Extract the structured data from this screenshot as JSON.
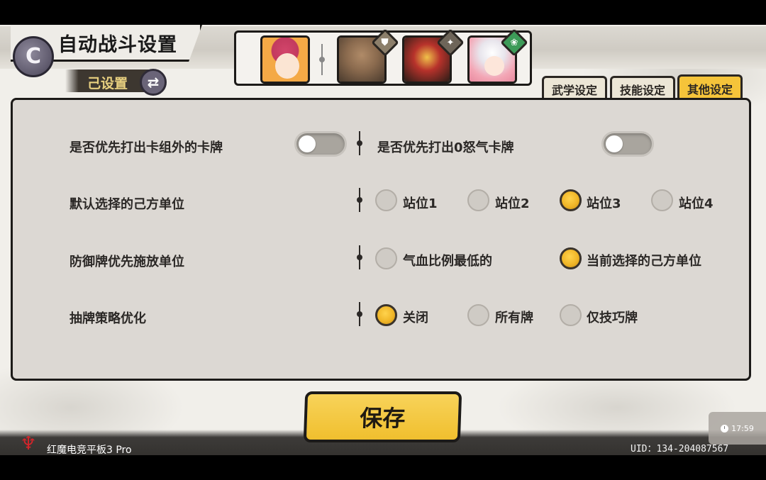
{
  "header": {
    "title": "自动战斗设置",
    "subtitle": "己设置",
    "back_glyph": "C"
  },
  "party": {
    "badges": [
      "⛊",
      "✦",
      "❀"
    ]
  },
  "tabs": [
    {
      "label": "武学设定",
      "active": false
    },
    {
      "label": "技能设定",
      "active": false
    },
    {
      "label": "其他设定",
      "active": true
    }
  ],
  "settings": {
    "row1": {
      "left_label": "是否优先打出卡组外的卡牌",
      "left_toggle_on": false,
      "right_label": "是否优先打出0怒气卡牌",
      "right_toggle_on": false
    },
    "row2": {
      "label": "默认选择的己方单位",
      "options": [
        "站位1",
        "站位2",
        "站位3",
        "站位4"
      ],
      "selected": "站位3"
    },
    "row3": {
      "label": "防御牌优先施放单位",
      "options": [
        "气血比例最低的",
        "当前选择的己方单位"
      ],
      "selected": "当前选择的己方单位"
    },
    "row4": {
      "label": "抽牌策略优化",
      "options": [
        "关闭",
        "所有牌",
        "仅技巧牌"
      ],
      "selected": "关闭"
    }
  },
  "save_label": "保存",
  "footer": {
    "device": "红魔电竞平板3 Pro",
    "uid": "UID：134-204087567",
    "time": "17:59"
  },
  "colors": {
    "accent_gold": "#f0bf2e",
    "panel_bg": "#dcd8d3",
    "outline": "#1c1a18"
  }
}
